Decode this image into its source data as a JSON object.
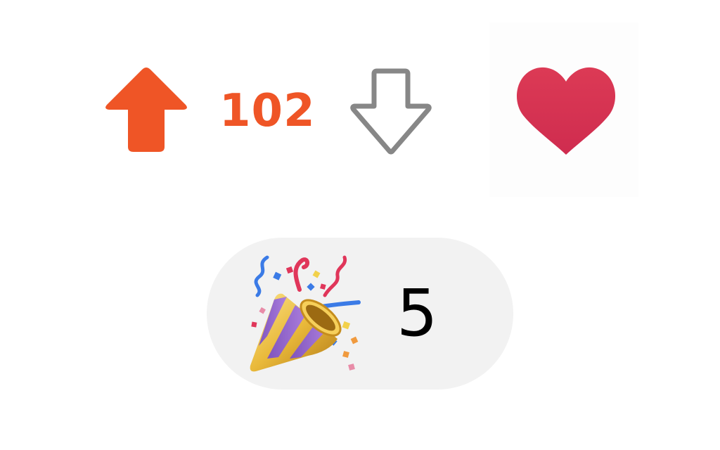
{
  "vote": {
    "score": "102",
    "upvote_icon": "arrow-up-filled-icon",
    "downvote_icon": "arrow-down-outline-icon"
  },
  "like": {
    "icon": "heart-icon"
  },
  "reaction": {
    "emoji_icon": "party-popper-icon",
    "count": "5"
  },
  "colors": {
    "upvote_active": "#ef5526",
    "downvote_inactive": "#878787",
    "heart": "#d93354",
    "pill_background": "#f2f2f2"
  }
}
